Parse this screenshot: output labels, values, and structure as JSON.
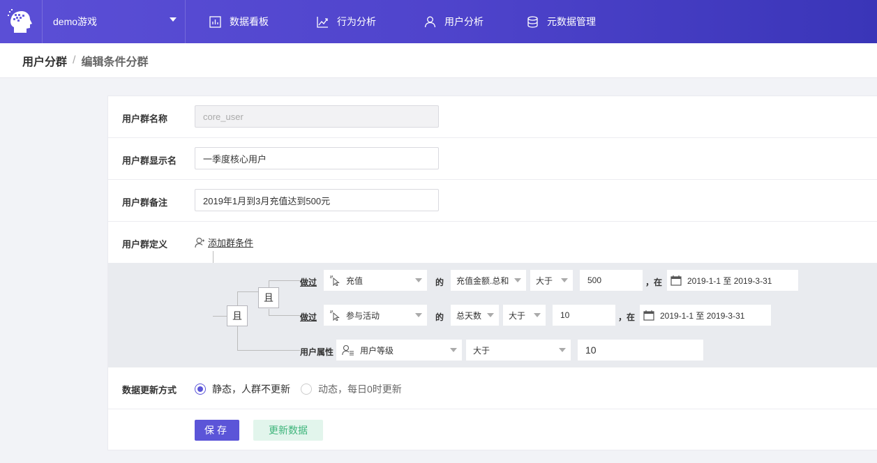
{
  "nav": {
    "project": "demo游戏",
    "items": [
      {
        "label": "数据看板",
        "icon": "bar-chart-icon"
      },
      {
        "label": "行为分析",
        "icon": "trend-line-icon"
      },
      {
        "label": "用户分析",
        "icon": "user-icon"
      },
      {
        "label": "元数据管理",
        "icon": "database-icon"
      }
    ]
  },
  "breadcrumb": {
    "root": "用户分群",
    "separator": "/",
    "current": "编辑条件分群"
  },
  "form": {
    "name_label": "用户群名称",
    "name_value": "core_user",
    "display_label": "用户群显示名",
    "display_value": "一季度核心用户",
    "note_label": "用户群备注",
    "note_value": "2019年1月到3月充值达到500元",
    "definition_label": "用户群定义",
    "add_condition": "添加群条件",
    "update_label": "数据更新方式",
    "update_options": [
      "静态，人群不更新",
      "动态，每日0时更新"
    ],
    "update_selected": 0
  },
  "conditions": {
    "outer_logic": "且",
    "inner_logic": "且",
    "rows": [
      {
        "type": "did",
        "verb": "做过",
        "event": "充值",
        "of": "的",
        "metric": "充值金额.总和",
        "op": "大于",
        "value": "500",
        "at": "，在",
        "date": "2019-1-1 至 2019-3-31"
      },
      {
        "type": "did",
        "verb": "做过",
        "event": "参与活动",
        "of": "的",
        "metric": "总天数",
        "op": "大于",
        "value": "10",
        "at": "，在",
        "date": "2019-1-1 至 2019-3-31"
      },
      {
        "type": "prop",
        "label": "用户属性",
        "prop": "用户等级",
        "op": "大于",
        "value": "10"
      }
    ]
  },
  "buttons": {
    "save": "保存",
    "update": "更新数据"
  },
  "colors": {
    "nav_start": "#5b4fd6",
    "nav_end": "#3a35b8",
    "primary": "#5b55d8",
    "success_text": "#3db47a"
  }
}
